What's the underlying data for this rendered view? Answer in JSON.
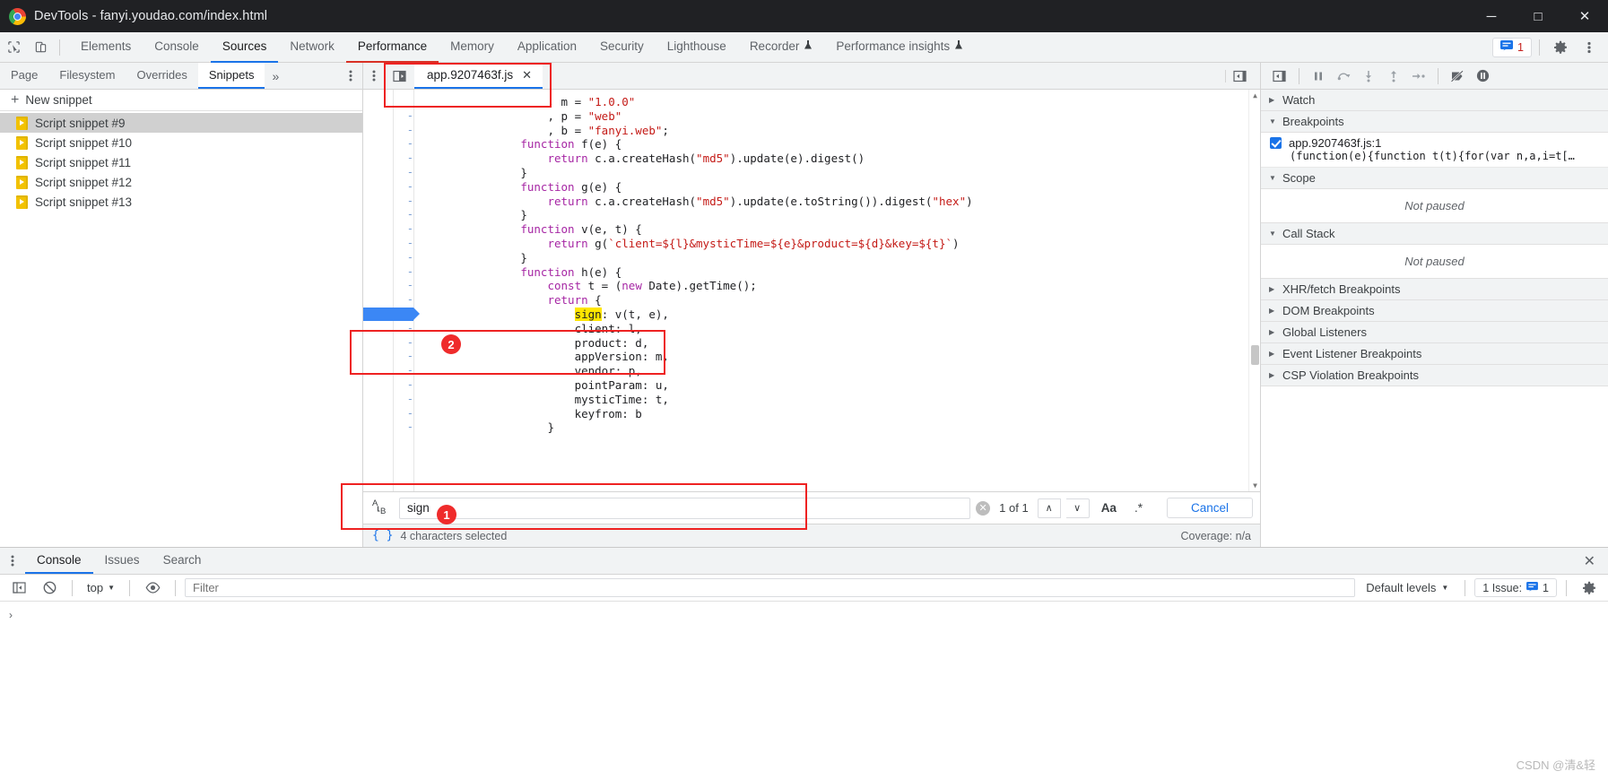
{
  "window": {
    "title": "DevTools - fanyi.youdao.com/index.html",
    "minimize": "─",
    "maximize": "□",
    "close": "✕"
  },
  "main_toolbar": {
    "inspect_icon": "cursor-inspect-icon",
    "device_icon": "device-toolbar-icon",
    "tabs": [
      {
        "label": "Elements",
        "state": "normal"
      },
      {
        "label": "Console",
        "state": "normal"
      },
      {
        "label": "Sources",
        "state": "active"
      },
      {
        "label": "Network",
        "state": "normal"
      },
      {
        "label": "Performance",
        "state": "red-underline"
      },
      {
        "label": "Memory",
        "state": "normal"
      },
      {
        "label": "Application",
        "state": "normal"
      },
      {
        "label": "Security",
        "state": "normal"
      },
      {
        "label": "Lighthouse",
        "state": "normal"
      },
      {
        "label": "Recorder",
        "state": "normal",
        "flask": "⚗"
      },
      {
        "label": "Performance insights",
        "state": "normal",
        "flask": "⚗"
      }
    ],
    "issues_count": "1",
    "settings_icon": "gear-icon",
    "more_icon": "kebab-menu-icon"
  },
  "navigator": {
    "tabs": [
      {
        "label": "Page",
        "active": false
      },
      {
        "label": "Filesystem",
        "active": false
      },
      {
        "label": "Overrides",
        "active": false
      },
      {
        "label": "Snippets",
        "active": true
      }
    ],
    "more_label": "»",
    "new_snippet": "New snippet",
    "snippets": [
      {
        "label": "Script snippet #9",
        "selected": true
      },
      {
        "label": "Script snippet #10",
        "selected": false
      },
      {
        "label": "Script snippet #11",
        "selected": false
      },
      {
        "label": "Script snippet #12",
        "selected": false
      },
      {
        "label": "Script snippet #13",
        "selected": false
      }
    ]
  },
  "editor": {
    "file_tab": "app.9207463f.js",
    "tab_close": "✕",
    "code_lines": [
      {
        "gutter": "",
        "segments": [
          {
            "t": "                  , ",
            "c": "plain"
          },
          {
            "t": "m",
            "c": "plain"
          },
          {
            "t": " = ",
            "c": "plain"
          },
          {
            "t": "\"1.0.0\"",
            "c": "str"
          }
        ]
      },
      {
        "gutter": "-",
        "segments": [
          {
            "t": "                  , p = ",
            "c": "plain"
          },
          {
            "t": "\"web\"",
            "c": "str"
          }
        ]
      },
      {
        "gutter": "-",
        "segments": [
          {
            "t": "                  , b = ",
            "c": "plain"
          },
          {
            "t": "\"fanyi.web\"",
            "c": "str"
          },
          {
            "t": ";",
            "c": "plain"
          }
        ]
      },
      {
        "gutter": "-",
        "segments": [
          {
            "t": "              ",
            "c": "plain"
          },
          {
            "t": "function",
            "c": "kw"
          },
          {
            "t": " f(e) {",
            "c": "plain"
          }
        ]
      },
      {
        "gutter": "-",
        "segments": [
          {
            "t": "                  ",
            "c": "plain"
          },
          {
            "t": "return",
            "c": "kw"
          },
          {
            "t": " c.a.createHash(",
            "c": "plain"
          },
          {
            "t": "\"md5\"",
            "c": "str"
          },
          {
            "t": ").update(e).digest()",
            "c": "plain"
          }
        ]
      },
      {
        "gutter": "-",
        "segments": [
          {
            "t": "              }",
            "c": "plain"
          }
        ]
      },
      {
        "gutter": "-",
        "segments": [
          {
            "t": "              ",
            "c": "plain"
          },
          {
            "t": "function",
            "c": "kw"
          },
          {
            "t": " g(e) {",
            "c": "plain"
          }
        ]
      },
      {
        "gutter": "-",
        "segments": [
          {
            "t": "                  ",
            "c": "plain"
          },
          {
            "t": "return",
            "c": "kw"
          },
          {
            "t": " c.a.createHash(",
            "c": "plain"
          },
          {
            "t": "\"md5\"",
            "c": "str"
          },
          {
            "t": ").update(e.toString()).digest(",
            "c": "plain"
          },
          {
            "t": "\"hex\"",
            "c": "str"
          },
          {
            "t": ")",
            "c": "plain"
          }
        ]
      },
      {
        "gutter": "-",
        "segments": [
          {
            "t": "              }",
            "c": "plain"
          }
        ]
      },
      {
        "gutter": "-",
        "segments": [
          {
            "t": "              ",
            "c": "plain"
          },
          {
            "t": "function",
            "c": "kw"
          },
          {
            "t": " v(e, t) {",
            "c": "plain"
          }
        ]
      },
      {
        "gutter": "-",
        "segments": [
          {
            "t": "                  ",
            "c": "plain"
          },
          {
            "t": "return",
            "c": "kw"
          },
          {
            "t": " g(",
            "c": "plain"
          },
          {
            "t": "`client=${l}&mysticTime=${e}&product=${d}&key=${t}`",
            "c": "str"
          },
          {
            "t": ")",
            "c": "plain"
          }
        ]
      },
      {
        "gutter": "-",
        "segments": [
          {
            "t": "              }",
            "c": "plain"
          }
        ]
      },
      {
        "gutter": "-",
        "segments": [
          {
            "t": "              ",
            "c": "plain"
          },
          {
            "t": "function",
            "c": "kw"
          },
          {
            "t": " h(e) {",
            "c": "plain"
          }
        ]
      },
      {
        "gutter": "-",
        "segments": [
          {
            "t": "                  ",
            "c": "plain"
          },
          {
            "t": "const",
            "c": "kw"
          },
          {
            "t": " t = (",
            "c": "plain"
          },
          {
            "t": "new",
            "c": "kw"
          },
          {
            "t": " Date).getTime();",
            "c": "plain"
          }
        ]
      },
      {
        "gutter": "-",
        "segments": [
          {
            "t": "                  ",
            "c": "plain"
          },
          {
            "t": "return",
            "c": "kw"
          },
          {
            "t": " {",
            "c": "plain"
          }
        ]
      },
      {
        "gutter": "-",
        "breakpoint": true,
        "segments": [
          {
            "t": "                      ",
            "c": "plain"
          },
          {
            "t": "sign",
            "c": "hl"
          },
          {
            "t": ": v(t, e),",
            "c": "plain"
          }
        ]
      },
      {
        "gutter": "-",
        "segments": [
          {
            "t": "                      client: l,",
            "c": "plain"
          }
        ]
      },
      {
        "gutter": "-",
        "segments": [
          {
            "t": "                      product: d,",
            "c": "plain"
          }
        ]
      },
      {
        "gutter": "-",
        "segments": [
          {
            "t": "                      appVersion: m,",
            "c": "plain"
          }
        ]
      },
      {
        "gutter": "-",
        "segments": [
          {
            "t": "                      vendor: p,",
            "c": "plain"
          }
        ]
      },
      {
        "gutter": "-",
        "segments": [
          {
            "t": "                      pointParam: u,",
            "c": "plain"
          }
        ]
      },
      {
        "gutter": "-",
        "segments": [
          {
            "t": "                      mysticTime: t,",
            "c": "plain"
          }
        ]
      },
      {
        "gutter": "-",
        "segments": [
          {
            "t": "                      keyfrom: b",
            "c": "plain"
          }
        ]
      },
      {
        "gutter": "-",
        "segments": [
          {
            "t": "                  }",
            "c": "plain"
          }
        ]
      }
    ]
  },
  "search": {
    "icon_label": "A↓B",
    "value": "sign",
    "placeholder": "",
    "clear": "✕",
    "match_count": "1 of 1",
    "prev": "∧",
    "next": "∨",
    "match_case": "Aa",
    "regex": ".*",
    "cancel": "Cancel"
  },
  "statusbar": {
    "pretty_print_icon": "format-braces-icon",
    "selection_text": "4 characters selected",
    "coverage": "Coverage: n/a"
  },
  "debugger": {
    "toolbar_icons": [
      "resume-script-icon",
      "step-over-icon",
      "step-into-icon",
      "step-out-icon",
      "step-icon",
      "deactivate-breakpoints-icon",
      "pause-on-exceptions-icon"
    ],
    "sections": [
      {
        "label": "Watch",
        "expanded": false
      },
      {
        "label": "Breakpoints",
        "expanded": true
      },
      {
        "label": "Scope",
        "expanded": true
      },
      {
        "label": "Call Stack",
        "expanded": true
      },
      {
        "label": "XHR/fetch Breakpoints",
        "expanded": false
      },
      {
        "label": "DOM Breakpoints",
        "expanded": false
      },
      {
        "label": "Global Listeners",
        "expanded": false
      },
      {
        "label": "Event Listener Breakpoints",
        "expanded": false
      },
      {
        "label": "CSP Violation Breakpoints",
        "expanded": false
      }
    ],
    "breakpoint": {
      "location": "app.9207463f.js:1",
      "snippet": "(function(e){function t(t){for(var n,a,i=t[…",
      "checked": true
    },
    "scope_state": "Not paused",
    "callstack_state": "Not paused"
  },
  "drawer": {
    "tabs": [
      {
        "label": "Console",
        "active": true
      },
      {
        "label": "Issues",
        "active": false
      },
      {
        "label": "Search",
        "active": false
      }
    ],
    "close": "✕",
    "context": "top",
    "filter_placeholder": "Filter",
    "levels": "Default levels",
    "issue_chip": "1 Issue:",
    "issue_count": "1",
    "prompt": "›",
    "settings_icon": "gear-icon"
  },
  "annotations": [
    {
      "id": "1",
      "label": "1"
    },
    {
      "id": "2",
      "label": "2"
    }
  ],
  "watermark": "CSDN @清&轻",
  "colors": {
    "accent_blue": "#1a73e8",
    "annotation_red": "#ee2222",
    "highlight_yellow": "#ffe600",
    "titlebar_bg": "#202124"
  }
}
